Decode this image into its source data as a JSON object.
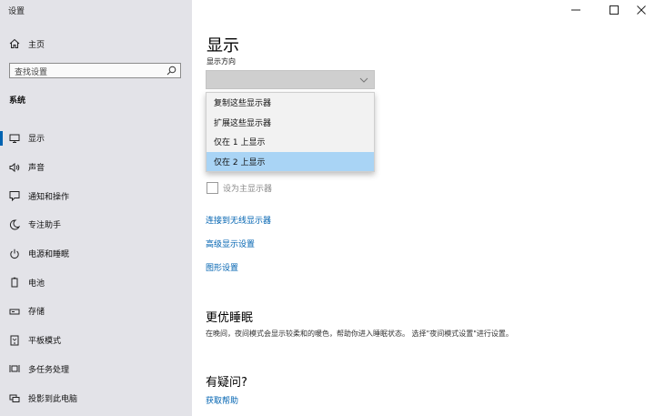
{
  "window": {
    "title": "设置",
    "minimize_glyph": "—",
    "maximize_glyph": "☐",
    "close_glyph": "✕"
  },
  "sidebar": {
    "home_label": "主页",
    "search_placeholder": "查找设置",
    "section_title": "系统",
    "items": [
      {
        "label": "显示",
        "icon": "monitor-icon",
        "active": true
      },
      {
        "label": "声音",
        "icon": "speaker-icon"
      },
      {
        "label": "通知和操作",
        "icon": "notification-icon"
      },
      {
        "label": "专注助手",
        "icon": "moon-icon"
      },
      {
        "label": "电源和睡眠",
        "icon": "power-icon"
      },
      {
        "label": "电池",
        "icon": "battery-icon"
      },
      {
        "label": "存储",
        "icon": "storage-icon"
      },
      {
        "label": "平板模式",
        "icon": "tablet-icon"
      },
      {
        "label": "多任务处理",
        "icon": "multitask-icon"
      },
      {
        "label": "投影到此电脑",
        "icon": "project-icon"
      }
    ]
  },
  "main": {
    "title": "显示",
    "orientation_label": "显示方向",
    "dropdown": {
      "options": [
        "复制这些显示器",
        "扩展这些显示器",
        "仅在 1 上显示",
        "仅在 2 上显示"
      ],
      "selected_index": 3
    },
    "primary_display_checkbox": "设为主显示器",
    "links": [
      "连接到无线显示器",
      "高级显示设置",
      "图形设置"
    ],
    "night_light": {
      "heading": "更优睡眠",
      "description": "在晚间，夜间模式会显示较柔和的暖色，帮助你进入睡眠状态。 选择\"夜间模式设置\"进行设置。"
    },
    "help": {
      "heading": "有疑问?",
      "link": "获取帮助"
    }
  },
  "colors": {
    "accent": "#0063b1",
    "sidebar_bg": "#e3e3e8",
    "selected_option_bg": "#a9d4f5"
  }
}
